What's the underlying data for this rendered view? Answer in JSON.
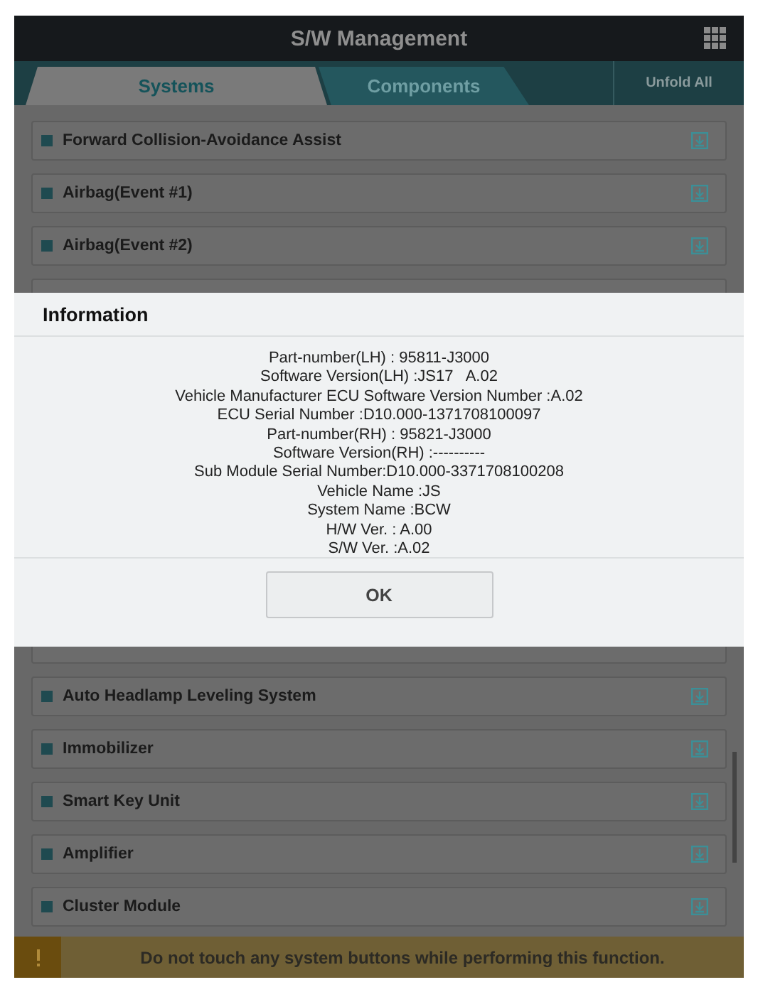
{
  "window": {
    "title": "S/W Management"
  },
  "tabs": [
    {
      "label": "Systems",
      "selected": true
    },
    {
      "label": "Components",
      "selected": false
    }
  ],
  "unfold_all": "Unfold All",
  "systems_top": [
    "Forward Collision-Avoidance Assist",
    "Airbag(Event #1)",
    "Airbag(Event #2)"
  ],
  "systems_bottom": [
    "Auto Headlamp Leveling System",
    "Immobilizer",
    "Smart Key Unit",
    "Amplifier",
    "Cluster Module"
  ],
  "dialog": {
    "title": "Information",
    "lines": [
      "Part-number(LH) : 95811-J3000",
      "Software Version(LH) :JS17   A.02",
      "Vehicle Manufacturer ECU Software Version Number :A.02",
      "ECU Serial Number :D10.000-1371708100097",
      "Part-number(RH) : 95821-J3000",
      "Software Version(RH) :----------",
      "Sub Module Serial Number:D10.000-3371708100208",
      "Vehicle Name :JS",
      "System Name :BCW",
      "H/W Ver. : A.00",
      "S/W Ver. :A.02"
    ],
    "button": "OK"
  },
  "warning": "Do not touch any system buttons while performing this function."
}
